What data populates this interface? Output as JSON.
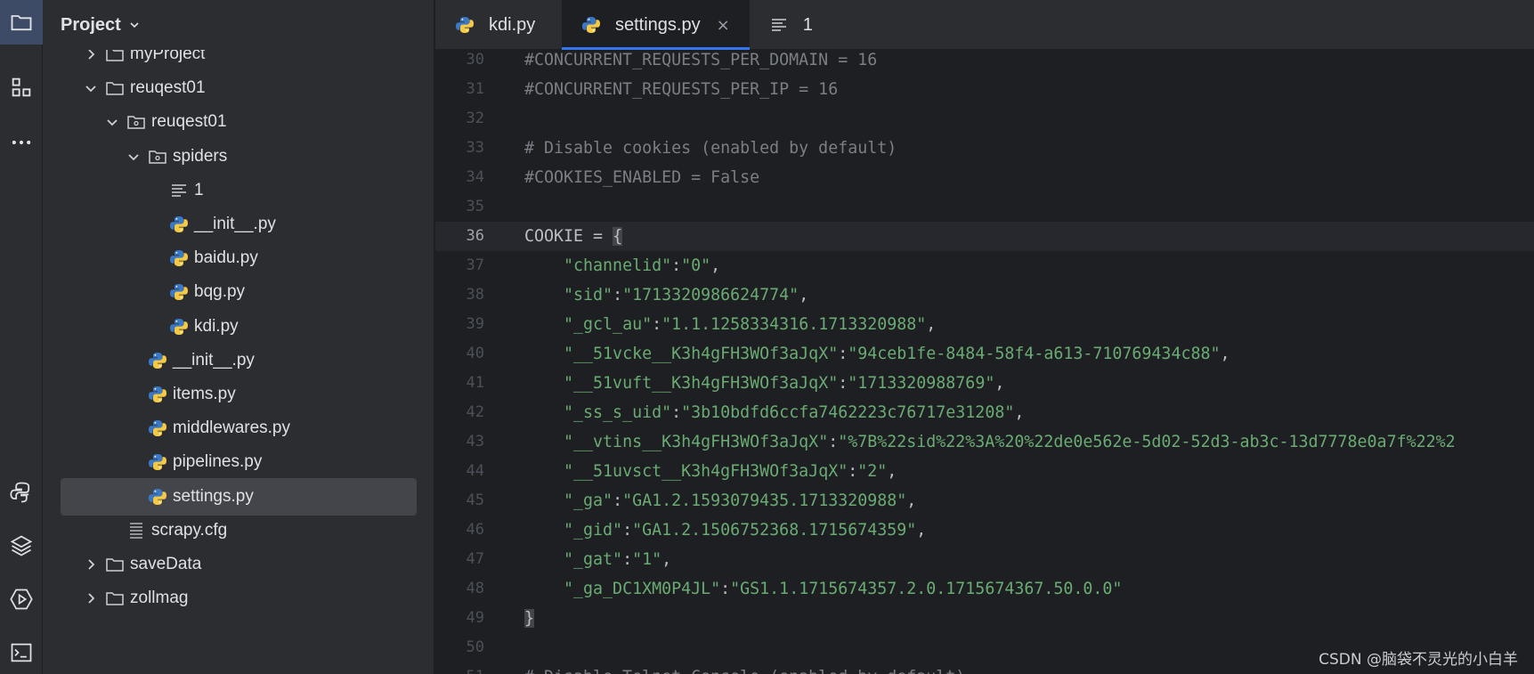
{
  "colors": {
    "accent": "#3574f0",
    "string": "#6aab73",
    "comment": "#7a7e85",
    "python_blue": "#3b79c6",
    "python_yellow": "#f3c945"
  },
  "activity_bar": {
    "items": [
      {
        "name": "project-folder-icon",
        "active": true
      },
      {
        "name": "structure-icon"
      },
      {
        "name": "more-icon"
      },
      {
        "name": "python-console-icon"
      },
      {
        "name": "python-packages-icon"
      },
      {
        "name": "services-icon"
      },
      {
        "name": "terminal-icon"
      }
    ]
  },
  "project_panel": {
    "title": "Project",
    "tree": [
      {
        "label": "myProject",
        "type": "folder",
        "expand": "right"
      },
      {
        "label": "reuqest01",
        "type": "folder",
        "expand": "down"
      },
      {
        "label": "reuqest01",
        "type": "package",
        "expand": "down"
      },
      {
        "label": "spiders",
        "type": "package",
        "expand": "down"
      },
      {
        "label": "1",
        "type": "text"
      },
      {
        "label": "__init__.py",
        "type": "python"
      },
      {
        "label": "baidu.py",
        "type": "python"
      },
      {
        "label": "bqg.py",
        "type": "python"
      },
      {
        "label": "kdi.py",
        "type": "python"
      },
      {
        "label": "__init__.py",
        "type": "python"
      },
      {
        "label": "items.py",
        "type": "python"
      },
      {
        "label": "middlewares.py",
        "type": "python"
      },
      {
        "label": "pipelines.py",
        "type": "python"
      },
      {
        "label": "settings.py",
        "type": "python",
        "selected": true
      },
      {
        "label": "scrapy.cfg",
        "type": "config"
      },
      {
        "label": "saveData",
        "type": "folder",
        "expand": "right"
      },
      {
        "label": "zollmag",
        "type": "folder",
        "expand": "right"
      }
    ]
  },
  "tabs": [
    {
      "label": "kdi.py",
      "icon": "python-icon"
    },
    {
      "label": "settings.py",
      "icon": "python-icon",
      "active": true,
      "close": "×"
    },
    {
      "label": "1",
      "icon": "text-file-icon"
    }
  ],
  "editor": {
    "current_line": "36",
    "lines": [
      {
        "no": "30",
        "segments": [
          {
            "t": "#CONCURRENT_REQUESTS_PER_DOMAIN = 16",
            "c": "com"
          }
        ]
      },
      {
        "no": "31",
        "segments": [
          {
            "t": "#CONCURRENT_REQUESTS_PER_IP = 16",
            "c": "com"
          }
        ]
      },
      {
        "no": "32",
        "segments": []
      },
      {
        "no": "33",
        "segments": [
          {
            "t": "# Disable cookies (enabled by default)",
            "c": "com"
          }
        ]
      },
      {
        "no": "34",
        "segments": [
          {
            "t": "#COOKIES_ENABLED = False",
            "c": "com"
          }
        ]
      },
      {
        "no": "35",
        "segments": []
      },
      {
        "no": "36",
        "segments": [
          {
            "t": "COOKIE = ",
            "c": "plain"
          },
          {
            "t": "{",
            "c": "brace"
          }
        ]
      },
      {
        "no": "37",
        "segments": [
          {
            "t": "    ",
            "c": "plain"
          },
          {
            "t": "\"channelid\"",
            "c": "str"
          },
          {
            "t": ":",
            "c": "plain"
          },
          {
            "t": "\"0\"",
            "c": "str"
          },
          {
            "t": ",",
            "c": "plain"
          }
        ]
      },
      {
        "no": "38",
        "segments": [
          {
            "t": "    ",
            "c": "plain"
          },
          {
            "t": "\"sid\"",
            "c": "str"
          },
          {
            "t": ":",
            "c": "plain"
          },
          {
            "t": "\"1713320986624774\"",
            "c": "str"
          },
          {
            "t": ",",
            "c": "plain"
          }
        ]
      },
      {
        "no": "39",
        "segments": [
          {
            "t": "    ",
            "c": "plain"
          },
          {
            "t": "\"_gcl_au\"",
            "c": "str"
          },
          {
            "t": ":",
            "c": "plain"
          },
          {
            "t": "\"1.1.1258334316.1713320988\"",
            "c": "str"
          },
          {
            "t": ",",
            "c": "plain"
          }
        ]
      },
      {
        "no": "40",
        "segments": [
          {
            "t": "    ",
            "c": "plain"
          },
          {
            "t": "\"__51vcke__K3h4gFH3WOf3aJqX\"",
            "c": "str"
          },
          {
            "t": ":",
            "c": "plain"
          },
          {
            "t": "\"94ceb1fe-8484-58f4-a613-710769434c88\"",
            "c": "str"
          },
          {
            "t": ",",
            "c": "plain"
          }
        ]
      },
      {
        "no": "41",
        "segments": [
          {
            "t": "    ",
            "c": "plain"
          },
          {
            "t": "\"__51vuft__K3h4gFH3WOf3aJqX\"",
            "c": "str"
          },
          {
            "t": ":",
            "c": "plain"
          },
          {
            "t": "\"1713320988769\"",
            "c": "str"
          },
          {
            "t": ",",
            "c": "plain"
          }
        ]
      },
      {
        "no": "42",
        "segments": [
          {
            "t": "    ",
            "c": "plain"
          },
          {
            "t": "\"_ss_s_uid\"",
            "c": "str"
          },
          {
            "t": ":",
            "c": "plain"
          },
          {
            "t": "\"3b10bdfd6ccfa7462223c76717e31208\"",
            "c": "str"
          },
          {
            "t": ",",
            "c": "plain"
          }
        ]
      },
      {
        "no": "43",
        "segments": [
          {
            "t": "    ",
            "c": "plain"
          },
          {
            "t": "\"__vtins__K3h4gFH3WOf3aJqX\"",
            "c": "str"
          },
          {
            "t": ":",
            "c": "plain"
          },
          {
            "t": "\"%7B%22sid%22%3A%20%22de0e562e-5d02-52d3-ab3c-13d7778e0a7f%22%2",
            "c": "str"
          }
        ]
      },
      {
        "no": "44",
        "segments": [
          {
            "t": "    ",
            "c": "plain"
          },
          {
            "t": "\"__51uvsct__K3h4gFH3WOf3aJqX\"",
            "c": "str"
          },
          {
            "t": ":",
            "c": "plain"
          },
          {
            "t": "\"2\"",
            "c": "str"
          },
          {
            "t": ",",
            "c": "plain"
          }
        ]
      },
      {
        "no": "45",
        "segments": [
          {
            "t": "    ",
            "c": "plain"
          },
          {
            "t": "\"_ga\"",
            "c": "str"
          },
          {
            "t": ":",
            "c": "plain"
          },
          {
            "t": "\"GA1.2.1593079435.1713320988\"",
            "c": "str"
          },
          {
            "t": ",",
            "c": "plain"
          }
        ]
      },
      {
        "no": "46",
        "segments": [
          {
            "t": "    ",
            "c": "plain"
          },
          {
            "t": "\"_gid\"",
            "c": "str"
          },
          {
            "t": ":",
            "c": "plain"
          },
          {
            "t": "\"GA1.2.1506752368.1715674359\"",
            "c": "str"
          },
          {
            "t": ",",
            "c": "plain"
          }
        ]
      },
      {
        "no": "47",
        "segments": [
          {
            "t": "    ",
            "c": "plain"
          },
          {
            "t": "\"_gat\"",
            "c": "str"
          },
          {
            "t": ":",
            "c": "plain"
          },
          {
            "t": "\"1\"",
            "c": "str"
          },
          {
            "t": ",",
            "c": "plain"
          }
        ]
      },
      {
        "no": "48",
        "segments": [
          {
            "t": "    ",
            "c": "plain"
          },
          {
            "t": "\"_ga_DC1XM0P4JL\"",
            "c": "str"
          },
          {
            "t": ":",
            "c": "plain"
          },
          {
            "t": "\"GS1.1.1715674357.2.0.1715674367.50.0.0\"",
            "c": "str"
          }
        ]
      },
      {
        "no": "49",
        "segments": [
          {
            "t": "}",
            "c": "brace"
          }
        ]
      },
      {
        "no": "50",
        "segments": []
      },
      {
        "no": "51",
        "segments": [
          {
            "t": "# Disable Telnet Console (enabled by default)",
            "c": "com"
          }
        ]
      }
    ]
  },
  "watermark": "CSDN @脑袋不灵光的小白羊"
}
